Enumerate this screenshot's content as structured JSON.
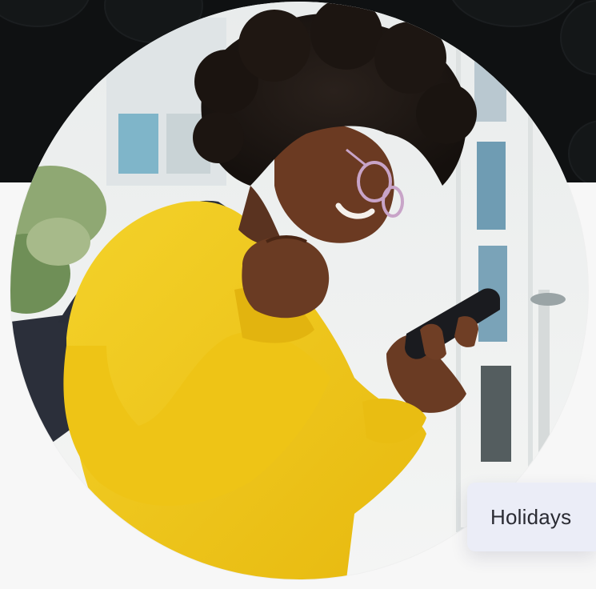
{
  "tag": {
    "label": "Holidays"
  },
  "colors": {
    "band": "#0f1112",
    "sweater": "#f1c81a",
    "tag_bg": "#ebedf7",
    "tag_text": "#2a2b33"
  },
  "icons": {
    "photo": "person-with-phone-photo"
  }
}
